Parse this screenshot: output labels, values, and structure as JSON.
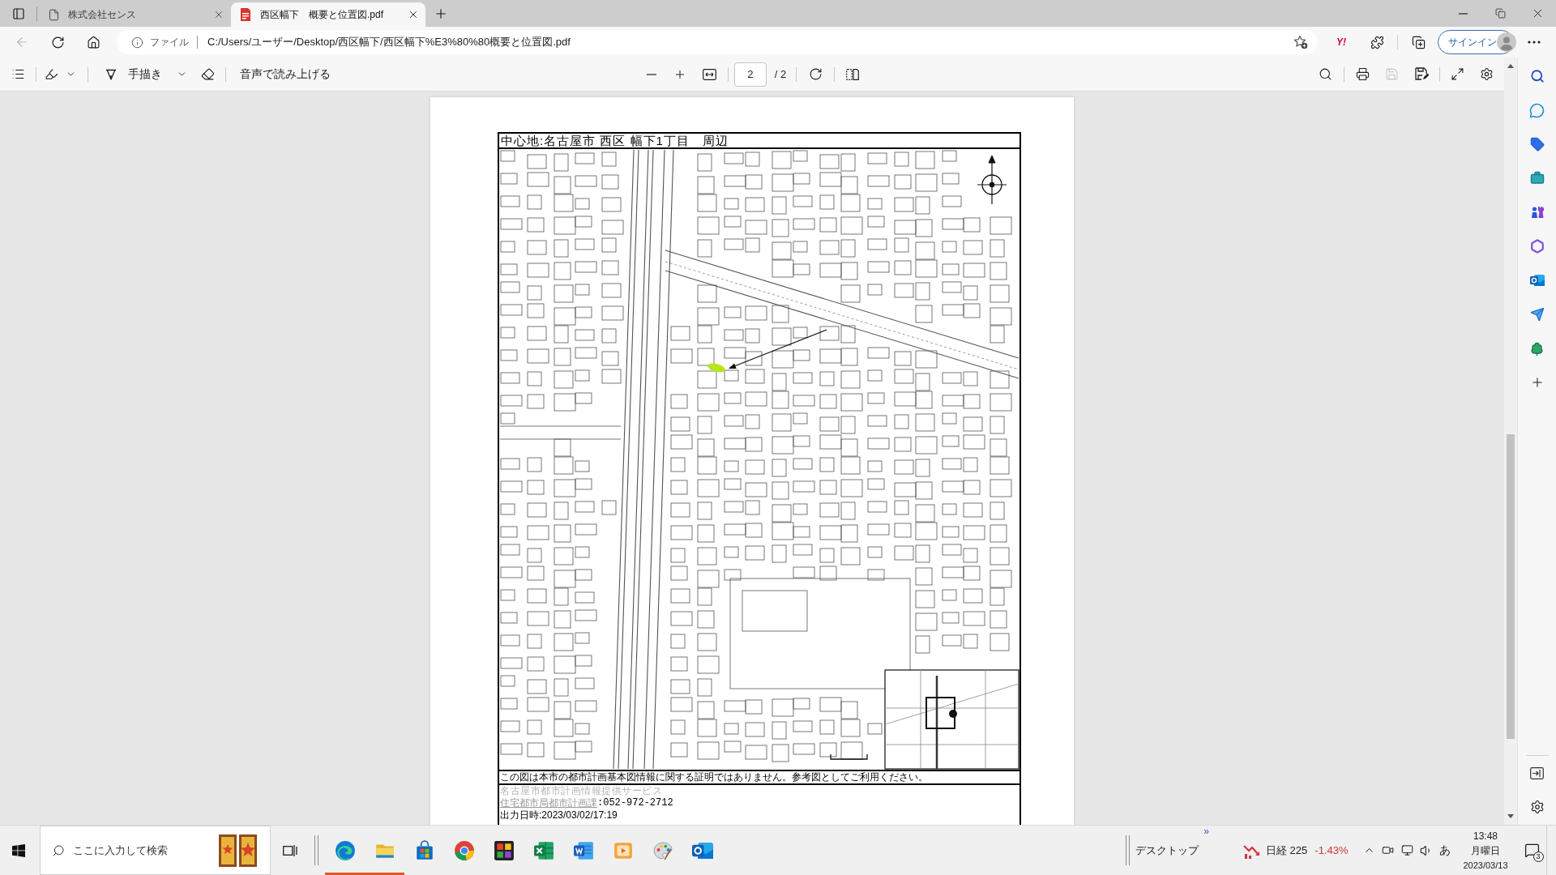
{
  "tabs": [
    {
      "kind": "page",
      "title": "株式会社センス",
      "selected": false
    },
    {
      "kind": "pdf",
      "title": "西区幅下　概要と位置図.pdf",
      "selected": true
    }
  ],
  "address_bar": {
    "scheme": "ファイル",
    "url": "C:/Users/ユーザー/Desktop/西区幅下/西区幅下%E3%80%80概要と位置図.pdf"
  },
  "toolbar": {
    "extension_badge": "Y!",
    "sign_in": "サインイン"
  },
  "pdf_toolbar": {
    "draw": "手描き",
    "read_aloud": "音声で読み上げる",
    "page": "2",
    "page_total": "/ 2",
    "save_disabled": true
  },
  "document": {
    "title": "中心地:名古屋市 西区 幅下1丁目　周辺",
    "disclaimer": "この図は本市の都市計画基本図情報に関する証明ではありません。参考図としてご利用ください。",
    "service": "名古屋市都市計画情報提供サービス",
    "department": "住宅都市局都市計画課",
    "phone": ":052-972-2712",
    "output_time": "出力日時:2023/03/02/17:19"
  },
  "taskbar": {
    "search_placeholder": "ここに入力して検索",
    "apps": [
      {
        "kind": "swirl",
        "running": true
      },
      {
        "kind": "folder",
        "running": true
      },
      {
        "kind": "bag",
        "running": false
      },
      {
        "kind": "orb",
        "running": false
      },
      {
        "kind": "tiles",
        "running": false
      },
      {
        "kind": "sheet",
        "running": false
      },
      {
        "kind": "doc",
        "running": false
      },
      {
        "kind": "play",
        "running": false
      },
      {
        "kind": "palette",
        "running": false
      },
      {
        "kind": "mail",
        "running": false
      }
    ],
    "toolbar_label": "デスクトップ",
    "toolbar_more": "»",
    "stock": {
      "name": "日経 225",
      "change": "-1.43%"
    },
    "ime": "あ",
    "clock": {
      "time": "13:48",
      "day": "月曜日",
      "date": "2023/03/13"
    },
    "notification_count": "3"
  }
}
